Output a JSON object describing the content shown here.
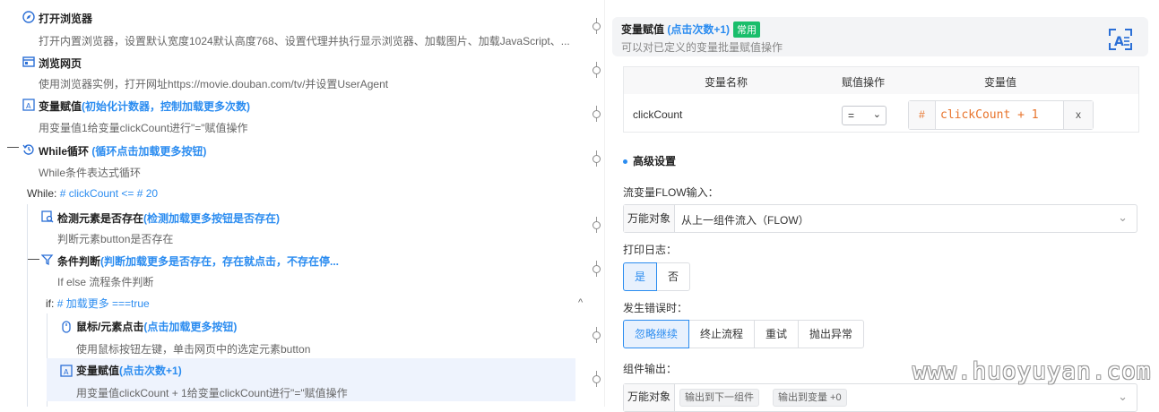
{
  "flow": {
    "steps": [
      {
        "title": "打开浏览器",
        "highlight": "",
        "desc": "打开内置浏览器，设置默认宽度1024默认高度768、设置代理并执行显示浏览器、加载图片、加载JavaScript、...",
        "icon": "compass-icon"
      },
      {
        "title": "浏览网页",
        "highlight": "",
        "desc": "使用浏览器实例，打开网址https://movie.douban.com/tv/并设置UserAgent",
        "icon": "browser-window-icon"
      },
      {
        "title": "变量赋值",
        "highlight": "(初始化计数器，控制加载更多次数)",
        "desc": "用变量值1给变量clickCount进行\"=\"赋值操作",
        "icon": "variable-assign-icon"
      },
      {
        "title": "While循环",
        "highlight": "(循环点击加载更多按钮)",
        "desc": "While条件表达式循环",
        "icon": "loop-icon"
      },
      {
        "title": "检测元素是否存在",
        "highlight": "(检测加载更多按钮是否存在)",
        "desc": "判断元素button是否存在",
        "icon": "element-check-icon"
      },
      {
        "title": "条件判断",
        "highlight": "(判断加载更多是否存在，存在就点击，不存在停...",
        "desc": "If else 流程条件判断",
        "icon": "condition-icon"
      },
      {
        "title": "鼠标/元素点击",
        "highlight": "(点击加载更多按钮)",
        "desc": "使用鼠标按钮左键，单击网页中的选定元素button",
        "icon": "mouse-icon"
      },
      {
        "title": "变量赋值",
        "highlight": "(点击次数+1)",
        "desc": "用变量值clickCount + 1给变量clickCount进行\"=\"赋值操作",
        "icon": "variable-assign-icon"
      }
    ],
    "while_label": "While:",
    "while_expr": "# clickCount <= # 20",
    "if_label": "if:",
    "if_expr": "# 加载更多 ===true",
    "collapse_sign": "—",
    "chevron_up": "^"
  },
  "panel": {
    "title": "变量赋值",
    "title_hl": "(点击次数+1)",
    "badge": "常用",
    "subtitle": "可以对已定义的变量批量赋值操作",
    "table": {
      "headers": [
        "变量名称",
        "赋值操作",
        "变量值"
      ],
      "rows": [
        {
          "name": "clickCount",
          "op": "=",
          "hash": "#",
          "value": "clickCount + 1",
          "remove": "x"
        }
      ]
    },
    "advanced_title": "高级设置",
    "flow_input_label": "流变量FLOW输入：",
    "flow_input_prefix": "万能对象",
    "flow_input_value": "从上一组件流入（FLOW）",
    "log_label": "打印日志：",
    "log_options": [
      "是",
      "否"
    ],
    "log_selected": "是",
    "error_label": "发生错误时：",
    "error_options": [
      "忽略继续",
      "终止流程",
      "重试",
      "抛出异常"
    ],
    "error_selected": "忽略继续",
    "output_label": "组件输出：",
    "output_prefix": "万能对象",
    "output_tags": [
      "输出到下一组件",
      "输出到变量 +0"
    ]
  },
  "watermark": "www.huoyuyan.com",
  "colors": {
    "accent": "#2b8cf0",
    "badge": "#19be6b",
    "code": "#e8742c"
  }
}
